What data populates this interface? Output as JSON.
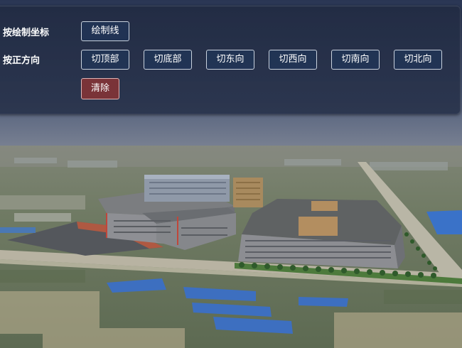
{
  "toolbar": {
    "draw_label": "按绘制坐标",
    "draw_line_button": "绘制线",
    "direction_label": "按正方向",
    "cut_top_button": "切顶部",
    "cut_bottom_button": "切底部",
    "cut_east_button": "切东向",
    "cut_west_button": "切西向",
    "cut_south_button": "切南向",
    "cut_north_button": "切北向",
    "clear_button": "清除"
  },
  "colors": {
    "panel_bg": "#222c44",
    "button_bg": "#20365a",
    "button_border": "#c9d2de",
    "clear_bg": "#7a3338",
    "sky": "#3a4a6a",
    "terrain": "#6e7a62",
    "building_roof": "#5f6263",
    "building_wall": "#8e8f94",
    "blue_roof": "#3a72c8"
  },
  "scene": {
    "description_icon": "3d-city-scene"
  }
}
